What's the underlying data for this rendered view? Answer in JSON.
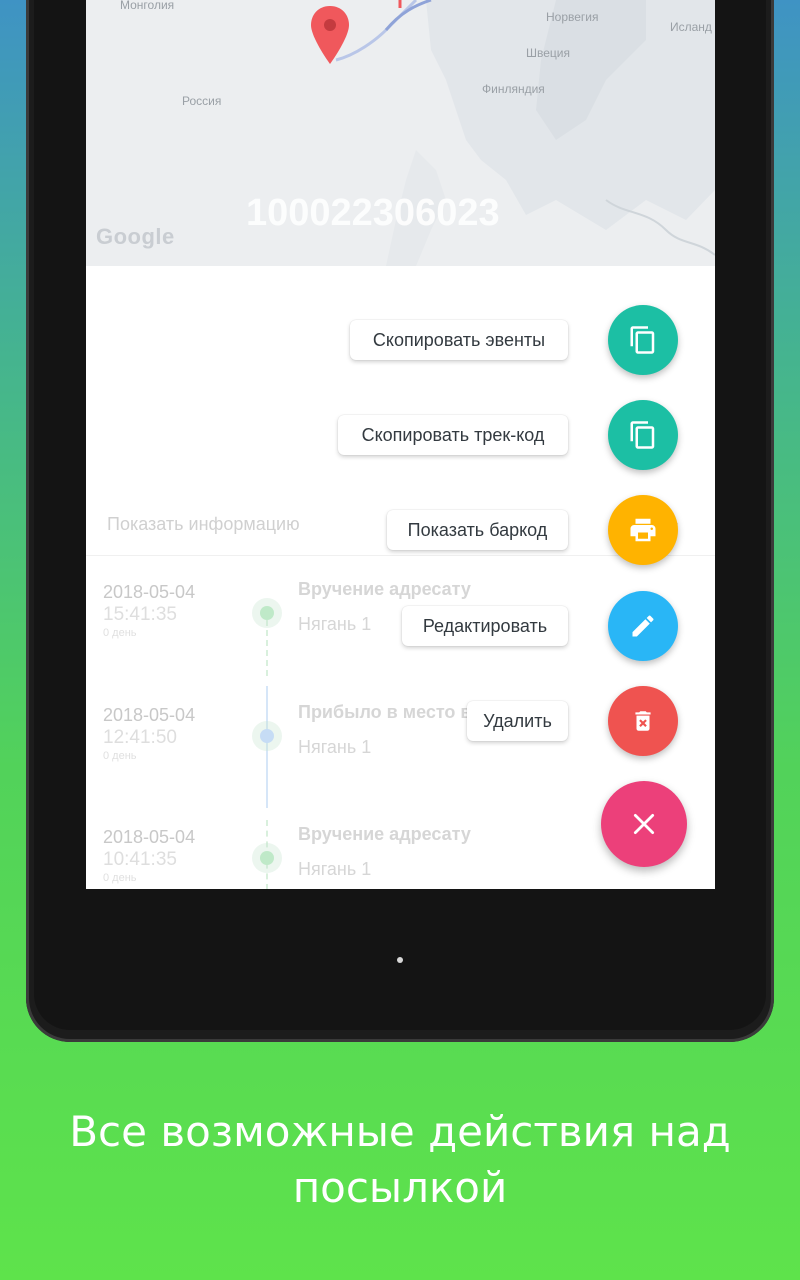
{
  "map": {
    "labels": [
      "Монголия",
      "Норвегия",
      "Исланд",
      "Швеция",
      "Россия",
      "Финляндия"
    ],
    "google_logo": "Google",
    "track_number": "100022306023",
    "pin_color": "#f0585c"
  },
  "info": {
    "label": "Показать информацию",
    "chevron": "⌄"
  },
  "events": [
    {
      "date": "2018-05-04",
      "time": "15:41:35",
      "day": "0 день",
      "title": "Вручение адресату",
      "place": "Нягань 1",
      "dot_color": "#bfe9c8"
    },
    {
      "date": "2018-05-04",
      "time": "12:41:50",
      "day": "0 день",
      "title": "Прибыло в место в",
      "place": "Нягань 1",
      "dot_color": "#c6dcf5"
    },
    {
      "date": "2018-05-04",
      "time": "10:41:35",
      "day": "0 день",
      "title": "Вручение адресату",
      "place": "Нягань 1",
      "dot_color": "#bfe9c8"
    }
  ],
  "actions": {
    "copy_events": "Скопировать эвенты",
    "copy_track": "Скопировать трек-код",
    "show_barcode": "Показать баркод",
    "edit": "Редактировать",
    "delete": "Удалить"
  },
  "colors": {
    "teal": "#1cbfa4",
    "amber": "#ffb300",
    "blue": "#29b6f6",
    "red": "#ef5350",
    "pink": "#ec407a"
  },
  "caption": {
    "line1": "Все возможные действия над",
    "line2": "посылкой"
  }
}
